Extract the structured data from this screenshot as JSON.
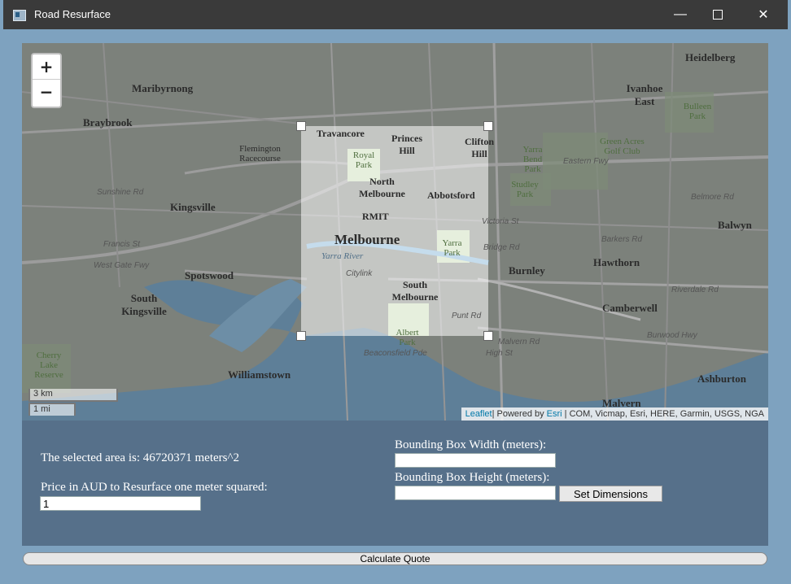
{
  "window": {
    "title": "Road Resurface",
    "minimize_glyph": "—",
    "close_glyph": "✕"
  },
  "map": {
    "zoom_in": "+",
    "zoom_out": "−",
    "scale_km": "3 km",
    "scale_mi": "1 mi",
    "attribution": {
      "leaflet": "Leaflet",
      "powered_by": "| Powered by ",
      "esri": "Esri",
      "rest": " | COM, Vicmap, Esri, HERE, Garmin, USGS, NGA"
    },
    "places": [
      "Heidelberg",
      "Maribyrnong",
      "Ivanhoe East",
      "Braybrook",
      "Flemington Racecourse",
      "Travancore",
      "Princes Hill",
      "Clifton Hill",
      "Royal Park",
      "North Melbourne",
      "Abbotsford",
      "Yarra Bend Park",
      "Green Acres Golf Club",
      "Kingsville",
      "RMIT",
      "Melbourne",
      "Yarra Park",
      "Burnley",
      "Hawthorn",
      "Balwyn",
      "Spotswood",
      "South Kingsville",
      "South Melbourne",
      "Camberwell",
      "Albert Park",
      "Williamstown",
      "Ashburton",
      "Malvern",
      "Cherry Lake Reserve",
      "Studley Park",
      "Bulleen Park"
    ],
    "roads": [
      "Eastern Fwy",
      "West Gate Fwy",
      "Citylink",
      "Burwood Hwy",
      "Beaconsfield Pde",
      "Punt Rd",
      "Victoria St",
      "Bridge Rd",
      "Barkers Rd",
      "Riverdale Rd",
      "Belmore Rd",
      "Sunshine Rd",
      "Francis St",
      "High St",
      "Malvern Rd",
      "Yarra River"
    ]
  },
  "panel": {
    "selected_area": "The selected area is: 46720371 meters^2",
    "price_label": "Price in AUD to Resurface one meter squared:",
    "price_value": "1",
    "width_label": "Bounding Box Width (meters):",
    "width_value": "",
    "height_label": "Bounding Box Height (meters):",
    "height_value": "",
    "set_dimensions": "Set Dimensions"
  },
  "calculate_button": "Calculate Quote",
  "colors": {
    "panel": "#56708a",
    "frame": "#7ea2bf",
    "titlebar": "#3a3a3a",
    "water": "#5e7f98",
    "link": "#0078a8"
  }
}
